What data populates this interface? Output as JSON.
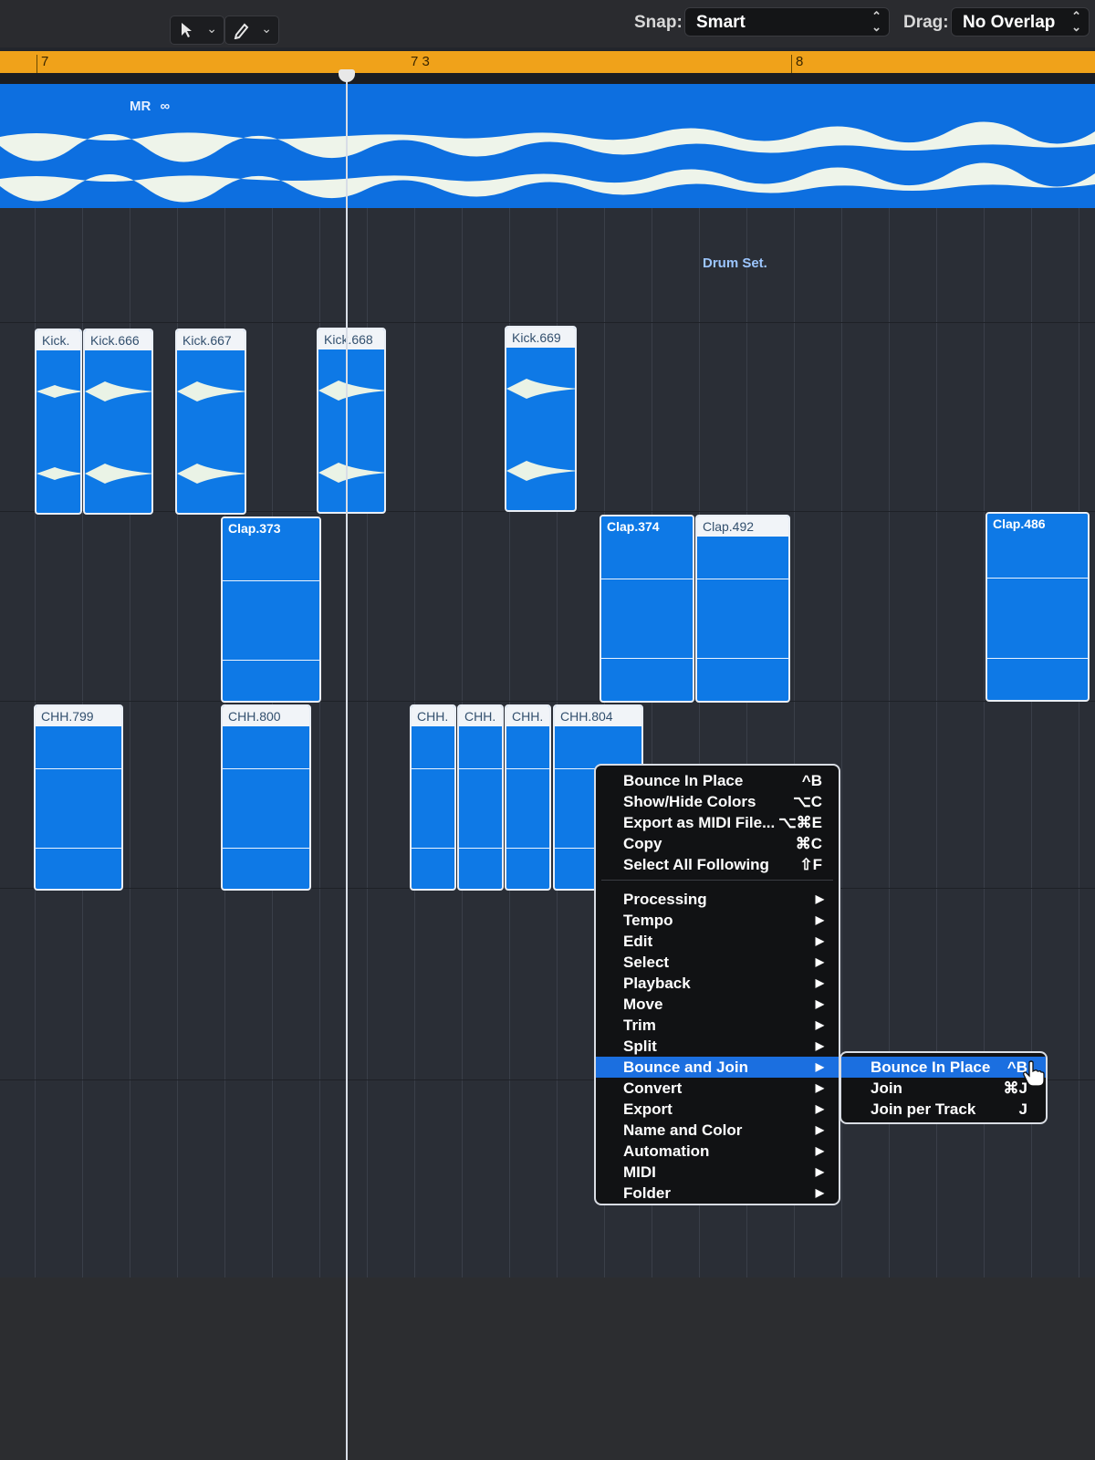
{
  "toolbar": {
    "snap_label": "Snap:",
    "snap_value": "Smart",
    "drag_label": "Drag:",
    "drag_value": "No Overlap"
  },
  "ruler": {
    "markers": [
      "7",
      "7 3",
      "8"
    ]
  },
  "tracks": {
    "mr_label": "MR",
    "drum_set_label": "Drum Set."
  },
  "regions": {
    "kicks": [
      "Kick.",
      "Kick.666",
      "Kick.667",
      "Kick.668",
      "Kick.669"
    ],
    "claps": [
      "Clap.373",
      "Clap.374",
      "Clap.492",
      "Clap.486"
    ],
    "hihats": [
      "CHH.799",
      "CHH.800",
      "CHH.",
      "CHH.",
      "CHH.",
      "CHH.804"
    ]
  },
  "context_menu": {
    "items": [
      {
        "label": "Bounce In Place",
        "shortcut": "^B"
      },
      {
        "label": "Show/Hide Colors",
        "shortcut": "⌥C"
      },
      {
        "label": "Export as MIDI File...",
        "shortcut": "⌥⌘E"
      },
      {
        "label": "Copy",
        "shortcut": "⌘C"
      },
      {
        "label": "Select All Following",
        "shortcut": "⇧F"
      }
    ],
    "submenus": [
      {
        "label": "Processing"
      },
      {
        "label": "Tempo"
      },
      {
        "label": "Edit"
      },
      {
        "label": "Select"
      },
      {
        "label": "Playback"
      },
      {
        "label": "Move"
      },
      {
        "label": "Trim"
      },
      {
        "label": "Split"
      },
      {
        "label": "Bounce and Join"
      },
      {
        "label": "Convert"
      },
      {
        "label": "Export"
      },
      {
        "label": "Name and Color"
      },
      {
        "label": "Automation"
      },
      {
        "label": "MIDI"
      },
      {
        "label": "Folder"
      }
    ],
    "highlighted": "Bounce and Join"
  },
  "submenu": {
    "items": [
      {
        "label": "Bounce In Place",
        "shortcut": "^B"
      },
      {
        "label": "Join",
        "shortcut": "⌘J"
      },
      {
        "label": "Join per Track",
        "shortcut": "J"
      }
    ]
  },
  "colors": {
    "region_blue": "#0e79e6",
    "ruler_orange": "#f0a21a",
    "menu_highlight": "#1b6fe0"
  }
}
